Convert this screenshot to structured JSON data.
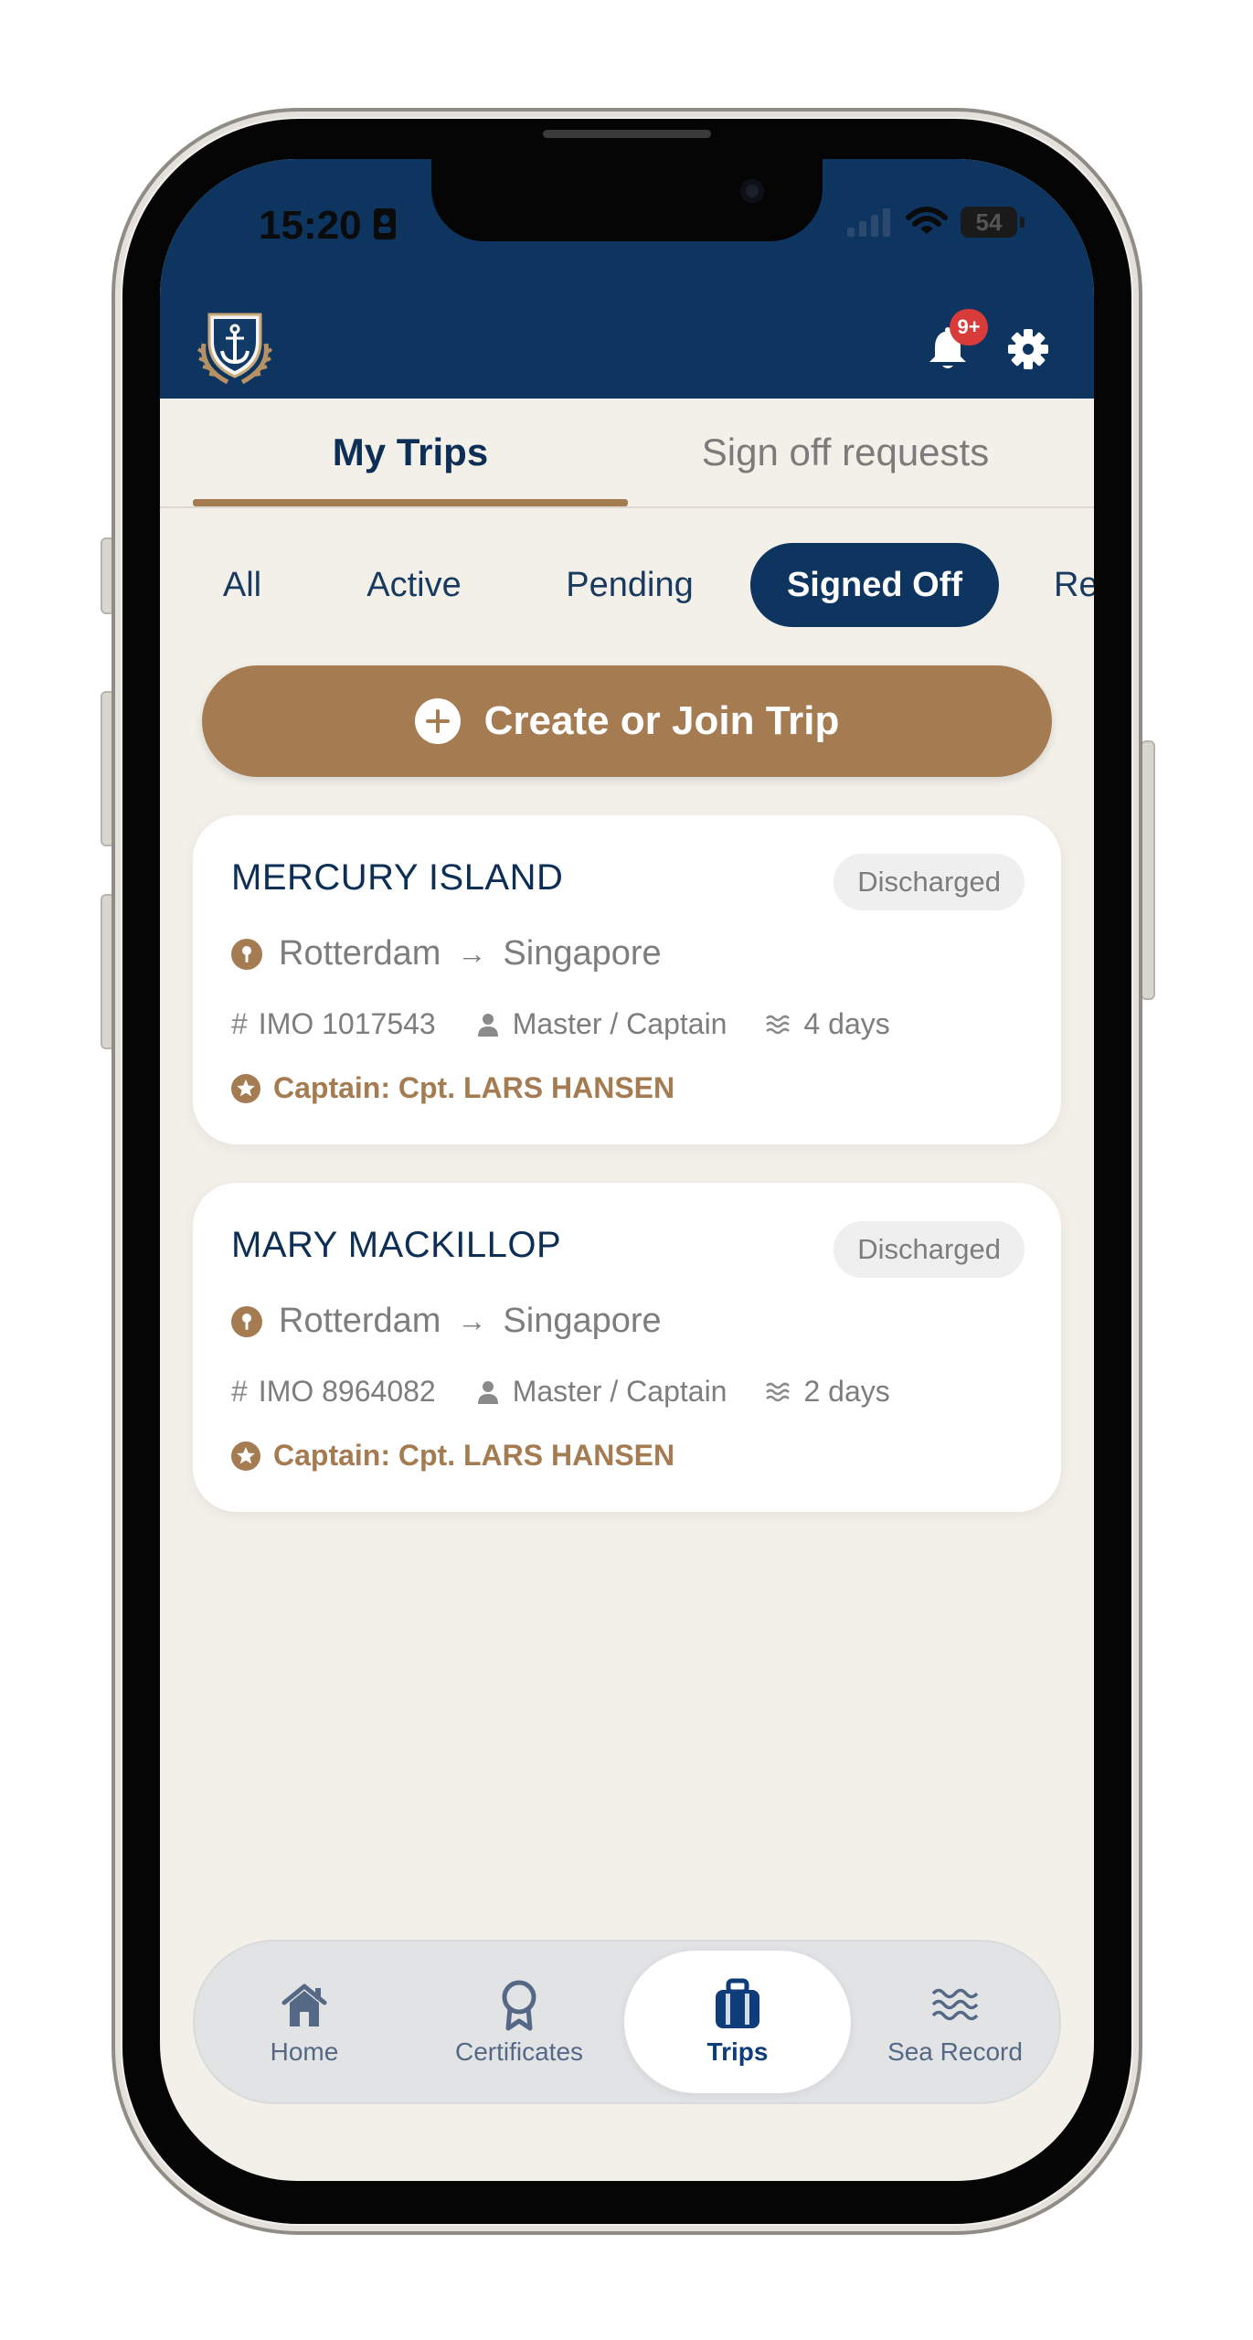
{
  "status_bar": {
    "time": "15:20",
    "battery": "54"
  },
  "header": {
    "notification_badge": "9+"
  },
  "tabs": [
    {
      "label": "My Trips",
      "active": true
    },
    {
      "label": "Sign off requests",
      "active": false
    }
  ],
  "filters": [
    {
      "label": "All",
      "selected": false
    },
    {
      "label": "Active",
      "selected": false
    },
    {
      "label": "Pending",
      "selected": false
    },
    {
      "label": "Signed Off",
      "selected": true
    },
    {
      "label": "Re",
      "selected": false
    }
  ],
  "create_button": {
    "label": "Create or Join Trip"
  },
  "trips": [
    {
      "vessel": "MERCURY ISLAND",
      "status": "Discharged",
      "from": "Rotterdam",
      "to": "Singapore",
      "imo": "IMO 1017543",
      "role": "Master / Captain",
      "duration": "4 days",
      "captain": "Captain: Cpt. LARS HANSEN"
    },
    {
      "vessel": "MARY MACKILLOP",
      "status": "Discharged",
      "from": "Rotterdam",
      "to": "Singapore",
      "imo": "IMO 8964082",
      "role": "Master / Captain",
      "duration": "2 days",
      "captain": "Captain: Cpt. LARS HANSEN"
    }
  ],
  "bottom_nav": [
    {
      "label": "Home",
      "icon": "home-icon",
      "active": false
    },
    {
      "label": "Certificates",
      "icon": "certificate-ribbon-icon",
      "active": false
    },
    {
      "label": "Trips",
      "icon": "briefcase-icon",
      "active": true
    },
    {
      "label": "Sea Record",
      "icon": "waves-icon",
      "active": false
    }
  ],
  "colors": {
    "header_navy": "#0e3460",
    "accent_bronze": "#a57b52",
    "background_cream": "#f3f0ea",
    "badge_red": "#d93a3a"
  }
}
